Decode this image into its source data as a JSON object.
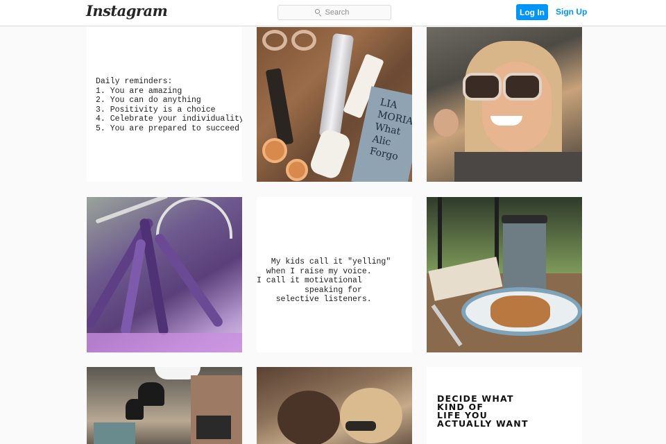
{
  "header": {
    "logo": "Instagram",
    "search_placeholder": "Search",
    "login_label": "Log In",
    "signup_label": "Sign Up"
  },
  "posts": [
    {
      "type": "text",
      "text": "Daily reminders:\n1. You are amazing\n2. You can do anything\n3. Positivity is a choice\n4. Celebrate your individuality\n5. You are prepared to succeed"
    },
    {
      "type": "photo",
      "subject": "skincare-products-and-book",
      "book_text": "LIA\nMORIA\nWhat\nAlic\nForgo"
    },
    {
      "type": "photo",
      "subject": "smiling-woman-selfie"
    },
    {
      "type": "photo",
      "subject": "lavender-bouquet-bicycle"
    },
    {
      "type": "text",
      "text": "   My kids call it \"yelling\"\n  when I raise my voice.\nI call it motivational\n          speaking for\n    selective listeners."
    },
    {
      "type": "photo",
      "subject": "coffee-cup-and-waffle"
    },
    {
      "type": "photo",
      "subject": "cafe-interior-lamps"
    },
    {
      "type": "photo",
      "subject": "two-women-outdoors"
    },
    {
      "type": "text",
      "text": "DECIDE WHAT\nKIND OF\nLIFE YOU\nACTUALLY WANT"
    }
  ],
  "colors": {
    "accent": "#0095f6",
    "header_bg": "#ffffff",
    "page_bg": "#fafafa",
    "border": "#dbdbdb"
  }
}
